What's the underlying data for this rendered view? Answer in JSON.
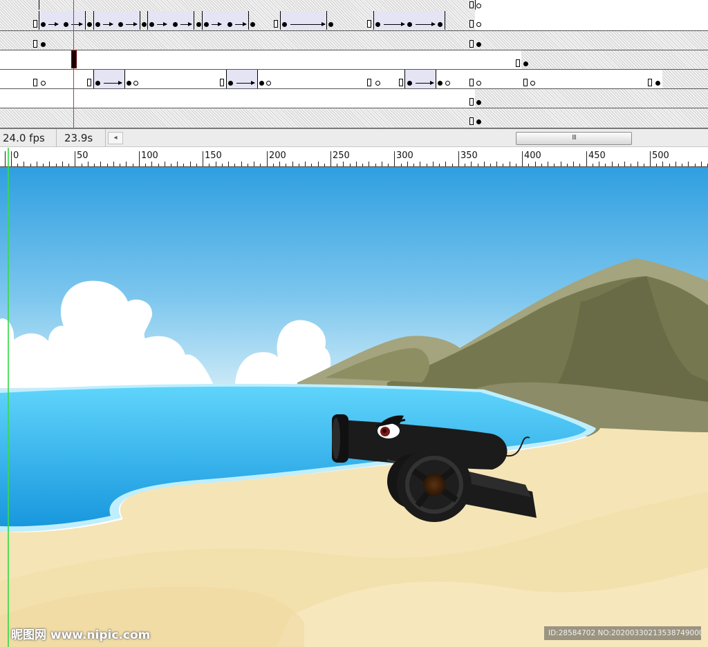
{
  "status_bar": {
    "fps": "24.0 fps",
    "elapsed_time": "23.9s",
    "scroll_left_glyph": "◂",
    "scroll_thumb_grip": "III"
  },
  "ruler": {
    "labels": [
      "0",
      "50",
      "100",
      "150",
      "200",
      "250",
      "300",
      "350",
      "400",
      "450",
      "500"
    ]
  },
  "watermark": {
    "logo": "昵图网 www.nipic.com",
    "id_text": "ID:28584702 NO:20200330213538749000"
  },
  "colors": {
    "playhead": "#c8322f",
    "tween_fill": "#e4e4f4",
    "guide_line": "#38d94a",
    "sky_top": "#2f9fe0",
    "sea": "#2db6ee",
    "sand": "#f5e4b6",
    "mountain": "#8c8c68",
    "cannon": "#1b1b1b"
  },
  "icons": {
    "keyframe_solid": "filled-keyframe-icon",
    "keyframe_empty": "empty-keyframe-icon",
    "tween_arrow": "motion-tween-arrow-icon",
    "end_frame": "end-frame-icon"
  }
}
